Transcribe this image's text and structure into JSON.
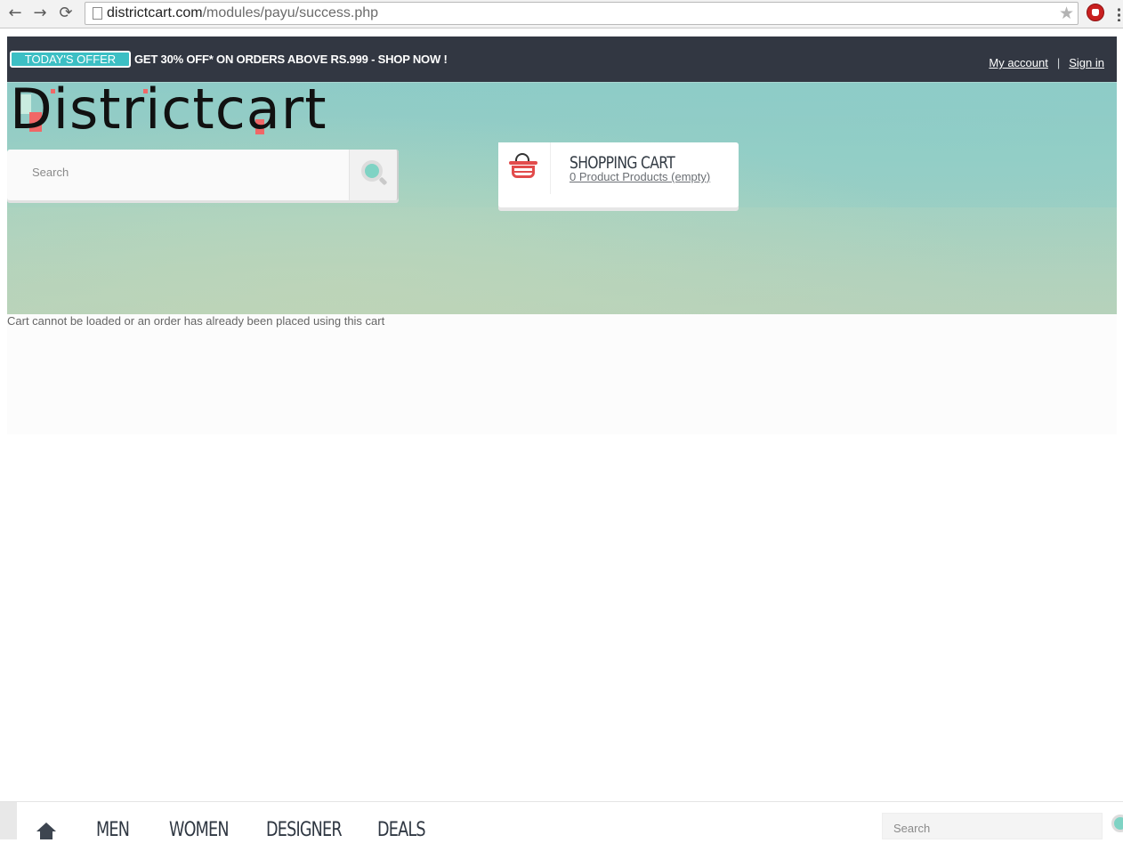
{
  "browser": {
    "url_host": "districtcart.com",
    "url_path": "/modules/payu/success.php",
    "back_glyph": "←",
    "forward_glyph": "→",
    "reload_glyph": "⟳",
    "star_glyph": "★"
  },
  "header": {
    "offer_badge": "TODAY'S OFFER",
    "offer_text": "GET 30% OFF* ON ORDERS ABOVE RS.999 - SHOP NOW !",
    "my_account": "My account",
    "separator": "|",
    "sign_in": "Sign in"
  },
  "logo": {
    "text": "Districtcart"
  },
  "search": {
    "placeholder": "Search"
  },
  "cart": {
    "title": "SHOPPING CART",
    "summary": "0 Product Products (empty)"
  },
  "content": {
    "message": "Cart cannot be loaded or an order has already been placed using this cart"
  },
  "bottom_nav": {
    "items": [
      "MEN",
      "WOMEN",
      "DESIGNER",
      "DEALS"
    ],
    "search_placeholder": "Search"
  },
  "colors": {
    "topbar": "#323742",
    "accent_teal": "#3cbfc4",
    "accent_red": "#e24b4b"
  },
  "icons": [
    "back-arrow-icon",
    "forward-arrow-icon",
    "reload-icon",
    "page-icon",
    "star-icon",
    "adblock-icon",
    "menu-icon",
    "search-icon",
    "basket-icon",
    "home-icon"
  ]
}
